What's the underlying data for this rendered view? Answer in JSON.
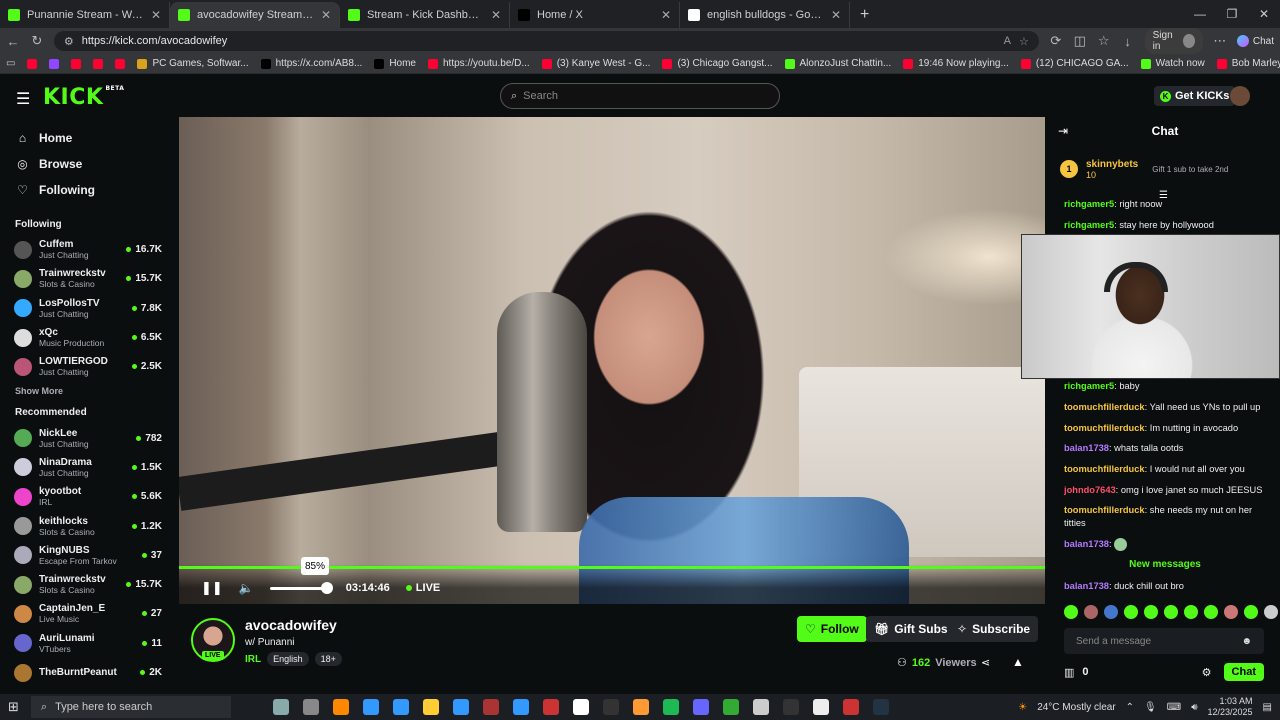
{
  "browser": {
    "tabs": [
      {
        "title": "Punannie Stream - Watch Live on",
        "fav": "#53fc18",
        "active": false
      },
      {
        "title": "avocadowifey Stream - Watc",
        "fav": "#53fc18",
        "active": true
      },
      {
        "title": "Stream - Kick Dashboard",
        "fav": "#53fc18",
        "active": false
      },
      {
        "title": "Home / X",
        "fav": "#000000",
        "active": false
      },
      {
        "title": "english bulldogs - Google Search",
        "fav": "#ffffff",
        "active": false
      }
    ],
    "url": "https://kick.com/avocadowifey",
    "sign_in": "Sign in",
    "chat": "Chat",
    "bookmarks": [
      {
        "label": "",
        "color": "#ff0033"
      },
      {
        "label": "",
        "color": "#9146ff"
      },
      {
        "label": "",
        "color": "#ff0033"
      },
      {
        "label": "",
        "color": "#ff0033"
      },
      {
        "label": "",
        "color": "#ff0033"
      },
      {
        "label": "PC Games, Softwar...",
        "color": "#d9a21b"
      },
      {
        "label": "https://x.com/AB8...",
        "color": "#000000"
      },
      {
        "label": "Home",
        "color": "#000000"
      },
      {
        "label": "https://youtu.be/D...",
        "color": "#ff0033"
      },
      {
        "label": "(3) Kanye West - G...",
        "color": "#ff0033"
      },
      {
        "label": "(3) Chicago Gangst...",
        "color": "#ff0033"
      },
      {
        "label": "AlonzoJust Chattin...",
        "color": "#53fc18"
      },
      {
        "label": "19:46 Now playing...",
        "color": "#ff0033"
      },
      {
        "label": "(12) CHICAGO GA...",
        "color": "#ff0033"
      },
      {
        "label": "Watch now",
        "color": "#53fc18"
      },
      {
        "label": "Bob Marley - Waiti...",
        "color": "#ff0033"
      }
    ]
  },
  "kick": {
    "logo": "KICK",
    "logo_beta": "BETA",
    "search_placeholder": "Search",
    "get_kicks": "Get KICKs",
    "nav": [
      {
        "label": "Home",
        "icon": "home-icon"
      },
      {
        "label": "Browse",
        "icon": "compass-icon"
      },
      {
        "label": "Following",
        "icon": "heart-icon"
      }
    ],
    "following_heading": "Following",
    "following": [
      {
        "name": "Cuffem",
        "category": "Just Chatting",
        "viewers": "16.7K",
        "color": "#555"
      },
      {
        "name": "Trainwreckstv",
        "category": "Slots & Casino",
        "viewers": "15.7K",
        "color": "#8a6"
      },
      {
        "name": "LosPollosTV",
        "category": "Just Chatting",
        "viewers": "7.8K",
        "color": "#3af"
      },
      {
        "name": "xQc",
        "category": "Music Production",
        "viewers": "6.5K",
        "color": "#ddd"
      },
      {
        "name": "LOWTIERGOD",
        "category": "Just Chatting",
        "viewers": "2.5K",
        "color": "#b57"
      }
    ],
    "show_more": "Show More",
    "recommended_heading": "Recommended",
    "recommended": [
      {
        "name": "NickLee",
        "category": "Just Chatting",
        "viewers": "782",
        "color": "#5a5"
      },
      {
        "name": "NinaDrama",
        "category": "Just Chatting",
        "viewers": "1.5K",
        "color": "#ccd"
      },
      {
        "name": "kyootbot",
        "category": "IRL",
        "viewers": "5.6K",
        "color": "#e4c"
      },
      {
        "name": "keithlocks",
        "category": "Slots & Casino",
        "viewers": "1.2K",
        "color": "#999"
      },
      {
        "name": "KingNUBS",
        "category": "Escape From Tarkov",
        "viewers": "37",
        "color": "#aab"
      },
      {
        "name": "Trainwreckstv",
        "category": "Slots & Casino",
        "viewers": "15.7K",
        "color": "#8a6"
      },
      {
        "name": "CaptainJen_E",
        "category": "Live Music",
        "viewers": "27",
        "color": "#c84"
      },
      {
        "name": "AuriLunami",
        "category": "VTubers",
        "viewers": "11",
        "color": "#66c"
      },
      {
        "name": "TheBurntPeanut",
        "category": "",
        "viewers": "2K",
        "color": "#a73"
      }
    ]
  },
  "player": {
    "volume_percent": "85%",
    "volume_level": 0.85,
    "time": "03:14:46",
    "live": "LIVE"
  },
  "stream": {
    "name": "avocadowifey",
    "with": "w/ Punanni",
    "category": "IRL",
    "tags": [
      "English",
      "18+"
    ],
    "live_badge": "LIVE",
    "follow": "Follow",
    "gift_subs": "Gift Subs",
    "subscribe": "Subscribe",
    "viewers": "162",
    "viewers_label": "Viewers"
  },
  "chat": {
    "title": "Chat",
    "pinned": {
      "rank": "1",
      "name": "skinnybets",
      "value": "10",
      "gift": "Gift 1 sub to take 2nd"
    },
    "messages": [
      {
        "user": "richgamer5",
        "text": "right noow",
        "color": "#53fc18"
      },
      {
        "user": "richgamer5",
        "text": "stay here by hollywood",
        "color": "#53fc18"
      },
      {
        "user": "richgamer5",
        "text": "baby",
        "color": "#53fc18"
      },
      {
        "user": "toomuchfillerduck",
        "text": "Yall need us YNs to pull up",
        "color": "#f5c542"
      },
      {
        "user": "toomuchfillerduck",
        "text": "Im nutting in avocado",
        "color": "#f5c542"
      },
      {
        "user": "balan1738",
        "text": "whats talla ootds",
        "color": "#b57bff"
      },
      {
        "user": "toomuchfillerduck",
        "text": "I would nut all over you",
        "color": "#f5c542"
      },
      {
        "user": "johndo7643",
        "text": "omg i love janet so much JEESUS",
        "color": "#ff4f6d"
      },
      {
        "user": "toomuchfillerduck",
        "text": "she needs my nut on her titties",
        "color": "#f5c542"
      },
      {
        "user": "balan1738",
        "text": "",
        "color": "#b57bff"
      }
    ],
    "new_messages": "New messages",
    "last_message": {
      "user": "balan1738",
      "text": "duck chill out bro",
      "color": "#b57bff"
    },
    "placeholder": "Send a message",
    "kicks_count": "0",
    "send": "Chat"
  },
  "taskbar": {
    "search": "Type here to search",
    "weather": "24°C  Mostly clear",
    "time": "1:03 AM",
    "date": "12/23/2025"
  }
}
